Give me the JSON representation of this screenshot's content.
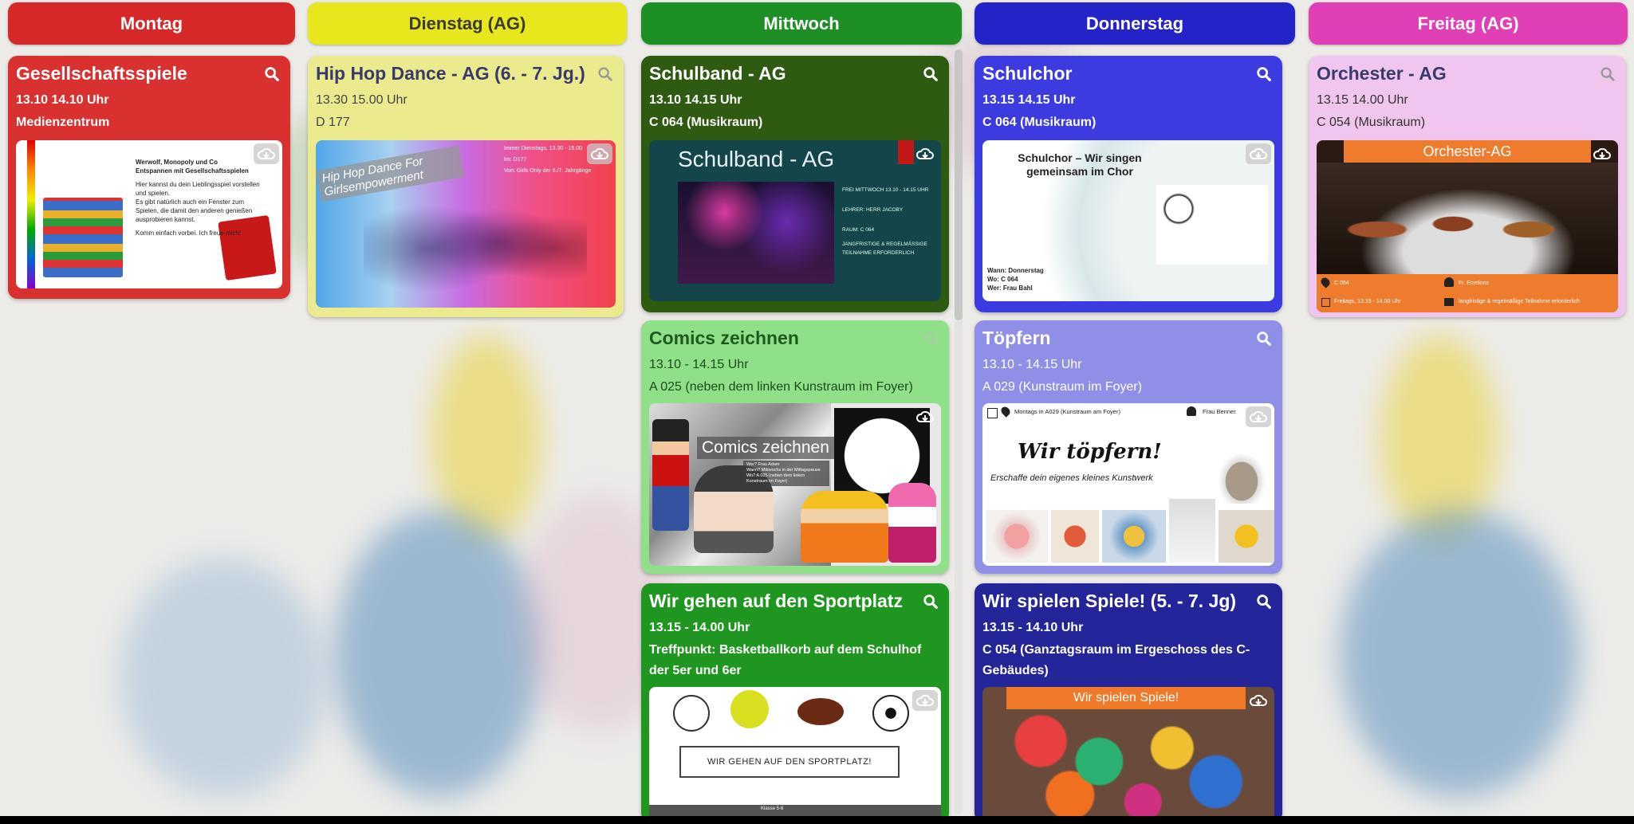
{
  "columns": [
    {
      "label": "Montag",
      "color": "#d62828",
      "text": "#ffffff"
    },
    {
      "label": "Dienstag (AG)",
      "color": "#e8e61c",
      "text": "#3a3a3a"
    },
    {
      "label": "Mittwoch",
      "color": "#1e8f25",
      "text": "#ffffff"
    },
    {
      "label": "Donnerstag",
      "color": "#2323c8",
      "text": "#ffffff"
    },
    {
      "label": "Freitag (AG)",
      "color": "#e03fb5",
      "text": "#ffffff"
    }
  ],
  "cards": {
    "montag_1": {
      "title": "Gesellschaftsspiele",
      "time": "13.10   14.10 Uhr",
      "room": "Medienzentrum",
      "color": "#d93030",
      "thumb_lines": [
        "Werwolf, Monopoly und Co",
        "Entspannen mit Gesellschaftsspielen",
        "Hier kannst du dein Lieblingsspiel vorstellen",
        "und spielen.",
        "Es gibt natürlich auch ein Fenster zum",
        "Spielen, die damit den anderen genießen",
        "ausprobieren kannst.",
        "Komm einfach vorbei. Ich freue mich!"
      ]
    },
    "dienstag_1": {
      "title": "Hip Hop Dance - AG (6. - 7. Jg.)",
      "time": "13.30   15.00 Uhr",
      "room": "D 177",
      "color": "#ecea8e",
      "thumb_banner": "Hip Hop Dance For Girlsempowerment",
      "thumb_info": [
        "Immer Dienstags, 13.30 - 15.00",
        "Im: D177",
        "Von: Girls Only der 6./7. Jahrgänge"
      ]
    },
    "mittwoch_1": {
      "title": "Schulband - AG",
      "time": "13.10   14.15 Uhr",
      "room": "C 064 (Musikraum)",
      "color": "#2f5a12",
      "thumb_title": "Schulband - AG",
      "thumb_info": [
        "FREI MITTWOCH 13.10 - 14.15 UHR",
        "LEHRER: HERR JACOBY",
        "RAUM: C 064",
        "JANGFRISTIGE & REGELMÄSSIGE TEILNAHME ERFORDERLICH"
      ]
    },
    "mittwoch_2": {
      "title": "Comics zeichnen",
      "time": "13.10 - 14.15 Uhr",
      "room": "A 025 (neben dem linken Kunstraum im Foyer)",
      "color": "#8fe088",
      "thumb_title": "Comics zeichnen",
      "thumb_info": [
        "Wer? Frau Adam",
        "Wann? Mittwochs in der Mittagspause",
        "Wo? A 025 (neben dem linken Kunstraum im Foyer)"
      ]
    },
    "mittwoch_3": {
      "title": "Wir gehen auf den Sportplatz",
      "time": "13.15 - 14.00 Uhr",
      "room": "Treffpunkt: Basketballkorb auf dem Schulhof der 5er und 6er",
      "color": "#1f961f",
      "thumb_button": "WIR GEHEN AUF DEN SPORTPLATZ!",
      "thumb_footer": "Klasse 5-6"
    },
    "donnerstag_1": {
      "title": "Schulchor",
      "time": "13.15   14.15 Uhr",
      "room": "C 064 (Musikraum)",
      "color": "#3b3be0",
      "thumb_title": "Schulchor – Wir singen gemeinsam im Chor",
      "thumb_info": [
        "Wann: Donnerstag",
        "Wo: C 064",
        "Wer: Frau Bahl"
      ]
    },
    "donnerstag_2": {
      "title": "Töpfern",
      "time": "13.10 - 14.15 Uhr",
      "room": "A 029 (Kunstraum im Foyer)",
      "color": "#8f8fe8",
      "thumb_header_left": "Montags in A029 (Kunstraum am Foyer)",
      "thumb_header_right": "Frau Benner",
      "thumb_title": "Wir töpfern!",
      "thumb_subtitle": "Erschaffe dein eigenes kleines Kunstwerk"
    },
    "donnerstag_3": {
      "title": "Wir spielen Spiele! (5. - 7. Jg)",
      "time": "13.15 - 14.10 Uhr",
      "room": "C 054 (Ganztagsraum im Ergeschoss des C-Gebäudes)",
      "color": "#25259a",
      "thumb_banner": "Wir spielen Spiele!"
    },
    "freitag_1": {
      "title": "Orchester - AG",
      "time": "13.15   14.00 Uhr",
      "room": "C 054 (Musikraum)",
      "color": "#f0c6ee",
      "thumb_banner": "Orchester-AG",
      "thumb_info": [
        "C 054",
        "Fr. Erretions",
        "Freitags, 13.15 - 14.00 Uhr",
        "langfristige & regelmäßige Teilnahme erforderlich"
      ]
    }
  }
}
